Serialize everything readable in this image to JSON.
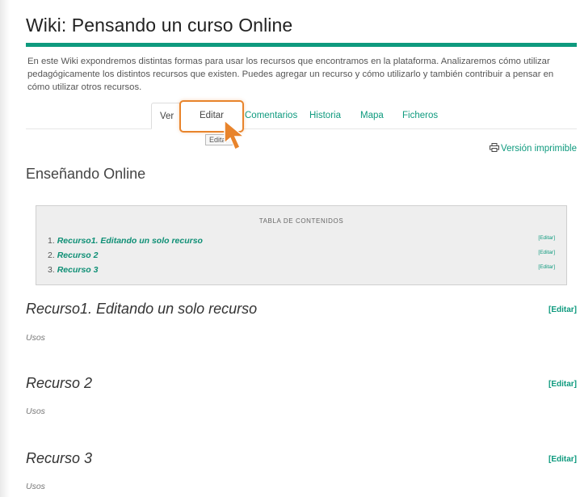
{
  "header": {
    "title": "Wiki: Pensando un curso Online",
    "intro": "En este Wiki expondremos distintas formas para usar los recursos que encontramos en la plataforma. Analizaremos cómo utilizar pedagógicamente los distintos recursos que existen. Puedes agregar un recurso y cómo utilizarlo y también contribuir a pensar en cómo utilizar otros recursos."
  },
  "tabs": {
    "ver": "Ver",
    "editar": "Editar",
    "comentarios": "Comentarios",
    "historia": "Historia",
    "mapa": "Mapa",
    "ficheros": "Ficheros",
    "tooltip": "Editar"
  },
  "print": {
    "label": "Versión imprimible",
    "icon": "printer-icon"
  },
  "page": {
    "section_title": "Enseñando Online"
  },
  "toc": {
    "title": "Tabla de contenidos",
    "items": [
      {
        "num": "1.",
        "label": "Recurso1. Editando un solo recurso",
        "edit": "[Editar]"
      },
      {
        "num": "2.",
        "label": "Recurso 2",
        "edit": "[Editar]"
      },
      {
        "num": "3.",
        "label": "Recurso 3",
        "edit": "[Editar]"
      }
    ]
  },
  "resources": [
    {
      "title": "Recurso1. Editando un solo recurso",
      "edit": "[Editar]",
      "usos": "Usos"
    },
    {
      "title": "Recurso 2",
      "edit": "[Editar]",
      "usos": "Usos"
    },
    {
      "title": "Recurso 3",
      "edit": "[Editar]",
      "usos": "Usos"
    }
  ],
  "colors": {
    "accent": "#0e9a7e",
    "highlight": "#e8842c"
  }
}
